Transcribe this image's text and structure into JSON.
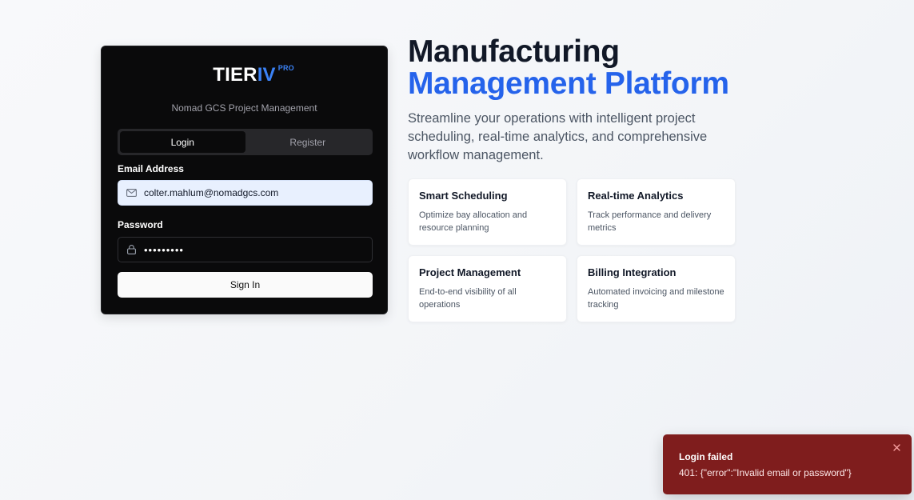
{
  "brand": {
    "logo_main": "TIER",
    "logo_accent": "IV",
    "logo_sup": "PRO",
    "subtitle": "Nomad GCS Project Management"
  },
  "auth": {
    "tabs": [
      {
        "label": "Login",
        "active": true
      },
      {
        "label": "Register",
        "active": false
      }
    ],
    "email_label": "Email Address",
    "email_value": "colter.mahlum@nomadgcs.com",
    "password_label": "Password",
    "password_value": "•••••••••",
    "signin_label": "Sign In",
    "email_icon": "mail-icon",
    "password_icon": "lock-icon"
  },
  "hero": {
    "title_line1": "Manufacturing",
    "title_line2": "Management Platform",
    "description": "Streamline your operations with intelligent project scheduling, real-time analytics, and comprehensive workflow management."
  },
  "features": [
    {
      "title": "Smart Scheduling",
      "desc": "Optimize bay allocation and resource planning"
    },
    {
      "title": "Real-time Analytics",
      "desc": "Track performance and delivery metrics"
    },
    {
      "title": "Project Management",
      "desc": "End-to-end visibility of all operations"
    },
    {
      "title": "Billing Integration",
      "desc": "Automated invoicing and milestone tracking"
    }
  ],
  "toast": {
    "title": "Login failed",
    "message": "401: {\"error\":\"Invalid email or password\"}",
    "close_icon": "close-icon"
  },
  "colors": {
    "accent": "#2563eb",
    "card_bg": "#0a0a0b",
    "toast_bg": "#7f1d1d",
    "page_bg": "#f5f7fa"
  }
}
